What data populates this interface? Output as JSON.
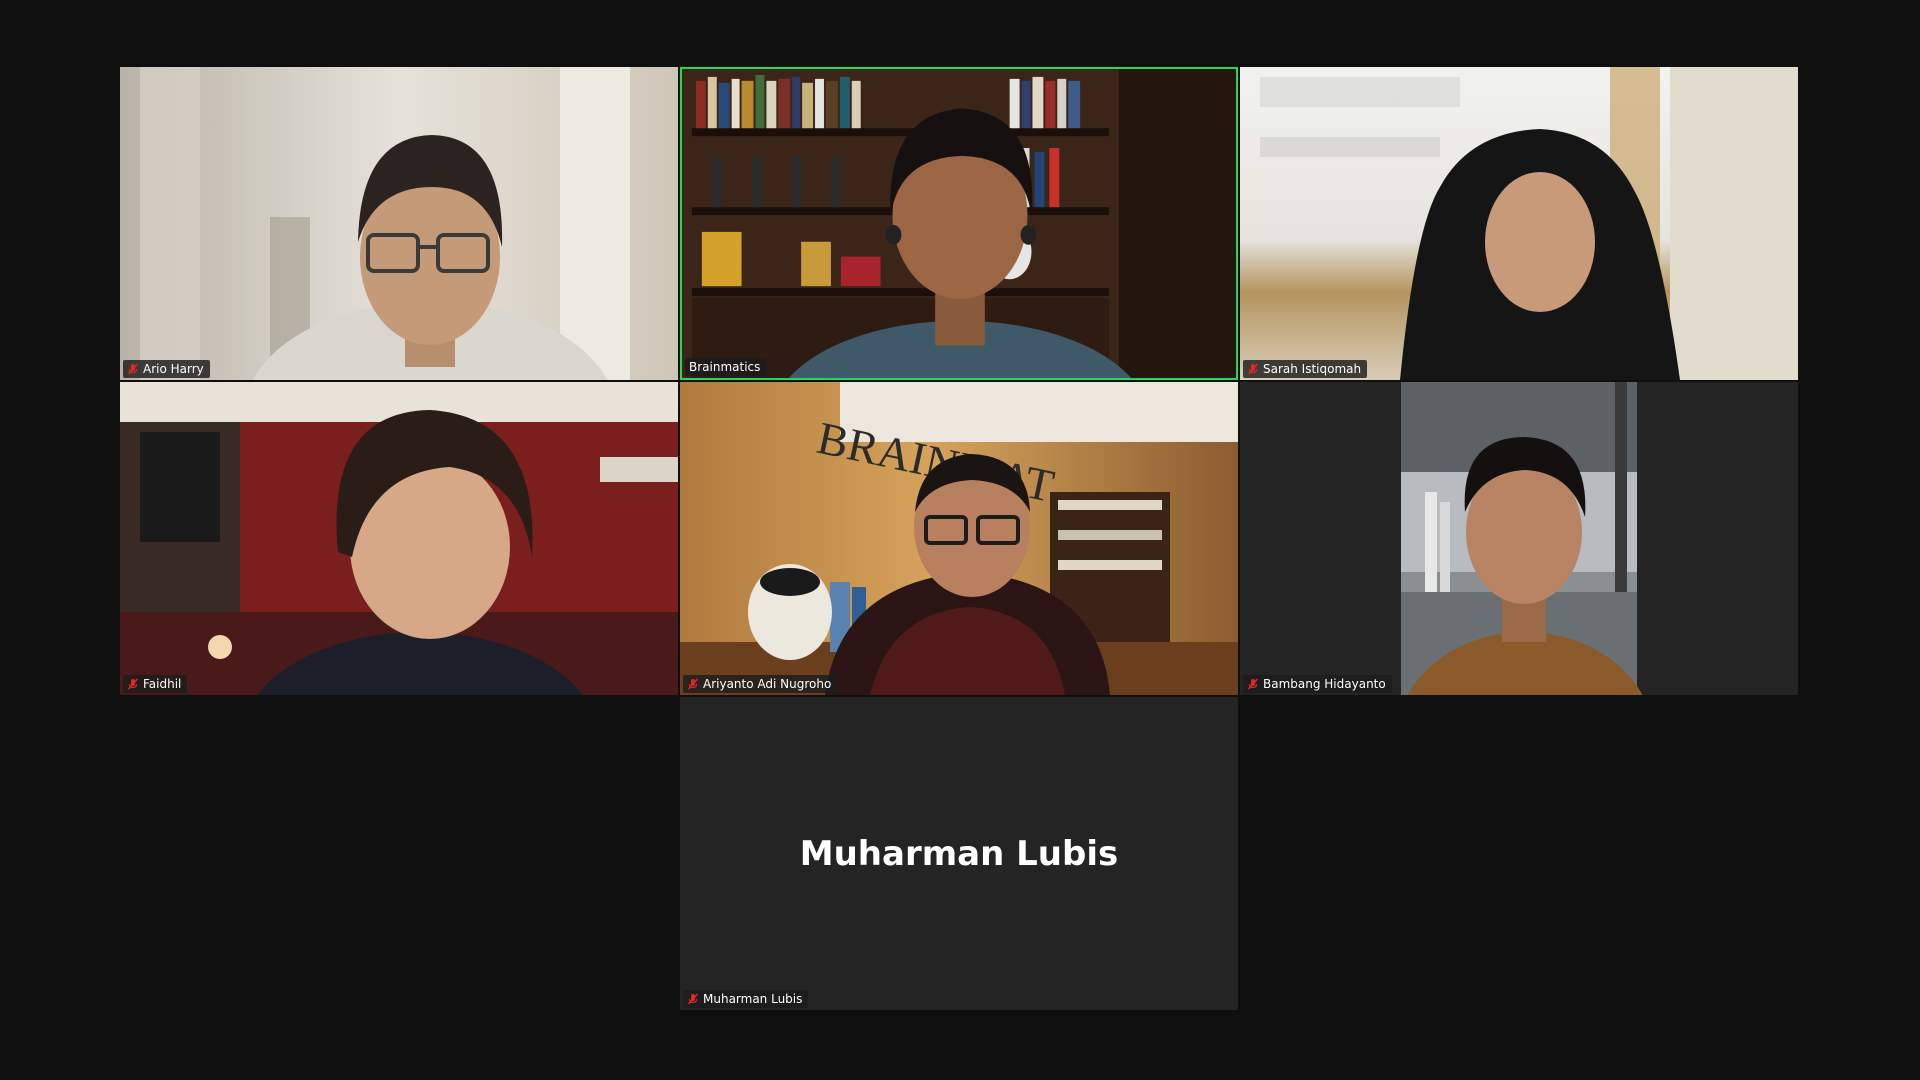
{
  "meeting": {
    "participants": [
      {
        "id": "p1",
        "name": "Ario Harry",
        "muted": true,
        "has_video": true
      },
      {
        "id": "p2",
        "name": "Brainmatics",
        "muted": false,
        "has_video": true,
        "active_speaker": true
      },
      {
        "id": "p3",
        "name": "Sarah Istiqomah",
        "muted": true,
        "has_video": true
      },
      {
        "id": "p4",
        "name": "Faidhil",
        "muted": true,
        "has_video": true
      },
      {
        "id": "p5",
        "name": "Ariyanto Adi Nugroho",
        "muted": true,
        "has_video": true,
        "background_sign": "BRAINMAT"
      },
      {
        "id": "p6",
        "name": "Bambang Hidayanto",
        "muted": true,
        "has_video": true
      },
      {
        "id": "p7",
        "name": "Muharman Lubis",
        "muted": true,
        "has_video": false,
        "display_name": "Muharman Lubis"
      }
    ]
  },
  "colors": {
    "app_background": "#0f0f0f",
    "tile_background": "#242424",
    "active_speaker_border": "#23d959",
    "mute_icon": "#e02828"
  }
}
